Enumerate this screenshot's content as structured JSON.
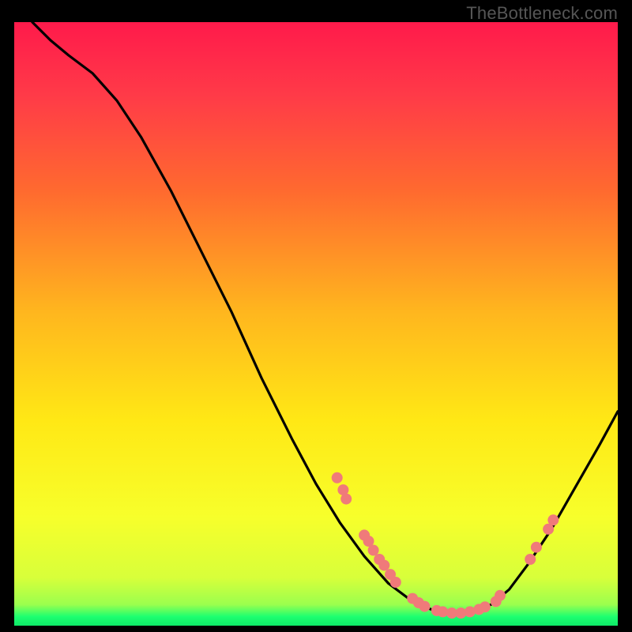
{
  "watermark": "TheBottleneck.com",
  "colors": {
    "gradient_top": "#ff1a4b",
    "gradient_mid_top": "#ff6a2f",
    "gradient_mid": "#ffe815",
    "gradient_low": "#f7ff2b",
    "gradient_green": "#1dff70",
    "curve": "#000000",
    "dot_fill": "#f07a7a",
    "dot_stroke": "#c94f4f"
  },
  "chart_data": {
    "type": "line",
    "title": "",
    "xlabel": "",
    "ylabel": "",
    "xlim": [
      0,
      100
    ],
    "ylim": [
      0,
      100
    ],
    "curve": [
      {
        "x": 3.0,
        "y": 100.0
      },
      {
        "x": 6.0,
        "y": 97.0
      },
      {
        "x": 9.0,
        "y": 94.5
      },
      {
        "x": 13.0,
        "y": 91.5
      },
      {
        "x": 17.0,
        "y": 87.0
      },
      {
        "x": 21.0,
        "y": 81.0
      },
      {
        "x": 26.0,
        "y": 72.0
      },
      {
        "x": 31.0,
        "y": 62.0
      },
      {
        "x": 36.0,
        "y": 52.0
      },
      {
        "x": 41.0,
        "y": 41.0
      },
      {
        "x": 46.0,
        "y": 31.0
      },
      {
        "x": 50.0,
        "y": 23.5
      },
      {
        "x": 54.0,
        "y": 17.0
      },
      {
        "x": 58.0,
        "y": 11.5
      },
      {
        "x": 62.0,
        "y": 7.0
      },
      {
        "x": 66.0,
        "y": 4.0
      },
      {
        "x": 70.0,
        "y": 2.3
      },
      {
        "x": 73.0,
        "y": 2.0
      },
      {
        "x": 76.0,
        "y": 2.3
      },
      {
        "x": 79.0,
        "y": 3.5
      },
      {
        "x": 82.0,
        "y": 6.0
      },
      {
        "x": 85.0,
        "y": 10.0
      },
      {
        "x": 89.0,
        "y": 16.0
      },
      {
        "x": 93.0,
        "y": 23.0
      },
      {
        "x": 97.0,
        "y": 30.0
      },
      {
        "x": 100.0,
        "y": 35.5
      }
    ],
    "dots": [
      {
        "x": 53.5,
        "y": 24.5
      },
      {
        "x": 54.5,
        "y": 22.5
      },
      {
        "x": 55.0,
        "y": 21.0
      },
      {
        "x": 58.0,
        "y": 15.0
      },
      {
        "x": 58.7,
        "y": 14.0
      },
      {
        "x": 59.5,
        "y": 12.5
      },
      {
        "x": 60.5,
        "y": 11.0
      },
      {
        "x": 61.3,
        "y": 10.0
      },
      {
        "x": 62.3,
        "y": 8.5
      },
      {
        "x": 63.2,
        "y": 7.2
      },
      {
        "x": 66.0,
        "y": 4.5
      },
      {
        "x": 67.0,
        "y": 3.8
      },
      {
        "x": 68.0,
        "y": 3.2
      },
      {
        "x": 70.0,
        "y": 2.5
      },
      {
        "x": 71.0,
        "y": 2.3
      },
      {
        "x": 72.5,
        "y": 2.1
      },
      {
        "x": 74.0,
        "y": 2.1
      },
      {
        "x": 75.5,
        "y": 2.3
      },
      {
        "x": 77.0,
        "y": 2.7
      },
      {
        "x": 78.0,
        "y": 3.1
      },
      {
        "x": 79.8,
        "y": 4.0
      },
      {
        "x": 80.5,
        "y": 5.0
      },
      {
        "x": 85.5,
        "y": 11.0
      },
      {
        "x": 86.5,
        "y": 13.0
      },
      {
        "x": 88.5,
        "y": 16.0
      },
      {
        "x": 89.3,
        "y": 17.5
      }
    ]
  }
}
